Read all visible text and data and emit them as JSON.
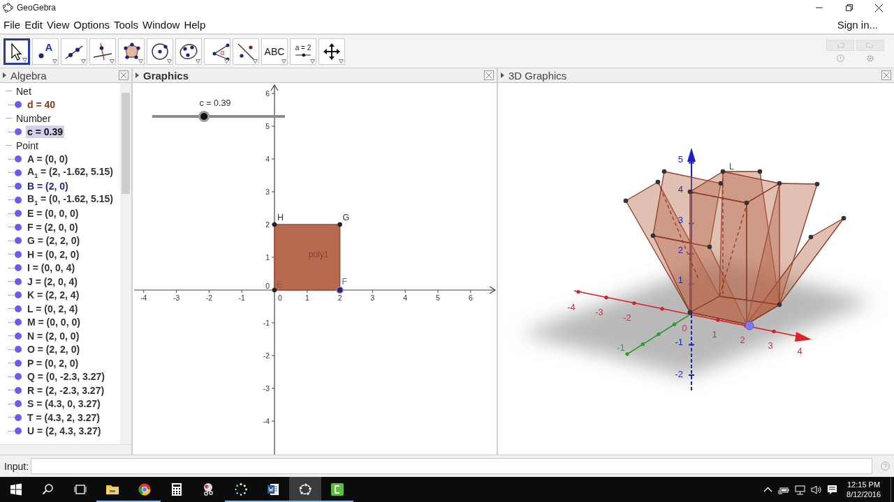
{
  "window": {
    "title": "GeoGebra"
  },
  "menu": [
    "File",
    "Edit",
    "View",
    "Options",
    "Tools",
    "Window",
    "Help"
  ],
  "sign_in": "Sign in...",
  "tools": [
    {
      "kind": "move",
      "selected": true
    },
    {
      "kind": "point",
      "label": "A",
      "selected": false
    },
    {
      "kind": "line",
      "selected": false
    },
    {
      "kind": "perpendicular",
      "selected": false
    },
    {
      "kind": "polygon",
      "selected": false
    },
    {
      "kind": "circle",
      "selected": false
    },
    {
      "kind": "conic",
      "selected": false
    },
    {
      "kind": "angle",
      "label": "α",
      "selected": false
    },
    {
      "kind": "reflect",
      "selected": false
    },
    {
      "kind": "text",
      "label": "ABC",
      "selected": false
    },
    {
      "kind": "slider",
      "label": "a = 2",
      "selected": false
    },
    {
      "kind": "move_view",
      "selected": false
    }
  ],
  "history": [
    {
      "kind": "undo",
      "disabled": true
    },
    {
      "kind": "redo",
      "disabled": true
    }
  ],
  "algebra": {
    "title": "Algebra",
    "active": false,
    "groups": [
      {
        "label": "Net",
        "expanded": true,
        "children": [
          {
            "text": "d = 40",
            "color": "#8b3a1a",
            "selected": false
          }
        ]
      },
      {
        "label": "Number",
        "expanded": true,
        "children": [
          {
            "text": "c = 0.39",
            "color": "#111111",
            "selected": true
          }
        ]
      },
      {
        "label": "Point",
        "expanded": true,
        "children": [
          {
            "text": "A = (0, 0)",
            "color": "#333333",
            "selected": false
          },
          {
            "text": "A$_{1}$ = (2, -1.62, 5.15)",
            "color": "#333333",
            "selected": false
          },
          {
            "text": "B = (2, 0)",
            "color": "#26268f",
            "selected": false
          },
          {
            "text": "B$_{1}$ = (0, -1.62, 5.15)",
            "color": "#333333",
            "selected": false
          },
          {
            "text": "E = (0, 0, 0)",
            "color": "#333333",
            "selected": false
          },
          {
            "text": "F = (2, 0, 0)",
            "color": "#333333",
            "selected": false
          },
          {
            "text": "G = (2, 2, 0)",
            "color": "#333333",
            "selected": false
          },
          {
            "text": "H = (0, 2, 0)",
            "color": "#333333",
            "selected": false
          },
          {
            "text": "I = (0, 0, 4)",
            "color": "#333333",
            "selected": false
          },
          {
            "text": "J = (2, 0, 4)",
            "color": "#333333",
            "selected": false
          },
          {
            "text": "K = (2, 2, 4)",
            "color": "#333333",
            "selected": false
          },
          {
            "text": "L = (0, 2, 4)",
            "color": "#333333",
            "selected": false
          },
          {
            "text": "M = (0, 0, 0)",
            "color": "#333333",
            "selected": false
          },
          {
            "text": "N = (2, 0, 0)",
            "color": "#333333",
            "selected": false
          },
          {
            "text": "O = (2, 2, 0)",
            "color": "#333333",
            "selected": false
          },
          {
            "text": "P = (0, 2, 0)",
            "color": "#333333",
            "selected": false
          },
          {
            "text": "Q = (0, -2.3, 3.27)",
            "color": "#333333",
            "selected": false
          },
          {
            "text": "R = (2, -2.3, 3.27)",
            "color": "#333333",
            "selected": false
          },
          {
            "text": "S = (4.3, 0, 3.27)",
            "color": "#333333",
            "selected": false
          },
          {
            "text": "T = (4.3, 2, 3.27)",
            "color": "#333333",
            "selected": false
          },
          {
            "text": "U = (2, 4.3, 3.27)",
            "color": "#333333",
            "selected": false
          }
        ]
      }
    ]
  },
  "graphics": {
    "title": "Graphics",
    "active": true,
    "slider": {
      "label": "c = 0.39",
      "level": 0.39
    },
    "x_ticks": [
      "-4",
      "-3",
      "-2",
      "-1",
      "0",
      "1",
      "2",
      "3",
      "4",
      "5",
      "6"
    ],
    "y_ticks": [
      "6",
      "5",
      "4",
      "3",
      "2",
      "1",
      "0",
      "-1",
      "-2",
      "-3",
      "-4"
    ],
    "polygon_label": "poly1",
    "point_labels": [
      "H",
      "G",
      "E",
      "F"
    ]
  },
  "graphics_3d": {
    "title": "3D Graphics",
    "active": false,
    "x_labels": [
      "-4",
      "-3",
      "-2",
      "1",
      "2",
      "3",
      "4"
    ],
    "y_labels": [
      "-1"
    ],
    "z_labels": [
      "5",
      "4",
      "3",
      "2",
      "1",
      "-1",
      "-2"
    ],
    "origin_label": "0",
    "point_labels": [
      "L"
    ]
  },
  "input_bar": {
    "label": "Input:"
  },
  "taskbar": {
    "apps": [
      {
        "kind": "start",
        "open": false,
        "active": false
      },
      {
        "kind": "search",
        "open": false,
        "active": false
      },
      {
        "kind": "task_view",
        "open": false,
        "active": false
      },
      {
        "kind": "explorer",
        "open": true,
        "active": false
      },
      {
        "kind": "browser",
        "open": true,
        "active": false
      },
      {
        "kind": "calculator",
        "open": false,
        "active": false
      },
      {
        "kind": "snipping",
        "open": false,
        "active": false
      },
      {
        "kind": "loader",
        "open": true,
        "active": false
      },
      {
        "kind": "word",
        "open": true,
        "active": false
      },
      {
        "kind": "geogebra",
        "open": true,
        "active": true
      },
      {
        "kind": "recorder",
        "open": true,
        "active": false
      }
    ],
    "tray": [
      {
        "kind": "chevron"
      },
      {
        "kind": "battery"
      },
      {
        "kind": "network"
      },
      {
        "kind": "volume"
      },
      {
        "kind": "notification"
      }
    ],
    "time": "12:15 PM",
    "date": "8/12/2016"
  }
}
